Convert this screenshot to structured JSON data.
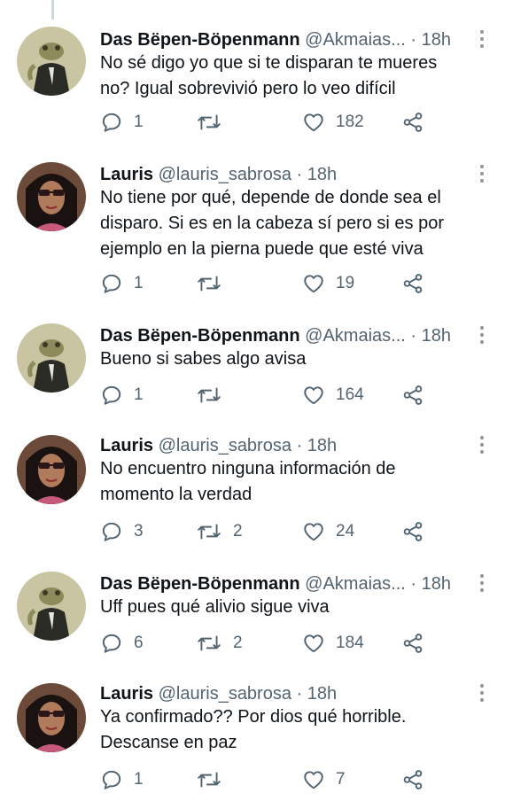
{
  "tweets": [
    {
      "author": "Das Bëpen-Böpenmann",
      "handle": "@Akmaias...",
      "separator": "·",
      "time": "18h",
      "lines": [
        "No sé digo yo que si te disparan te mueres",
        "no? Igual sobrevivió pero lo veo difícil"
      ],
      "replies": "1",
      "retweets": "",
      "likes": "182",
      "avatar": "frog-avatar"
    },
    {
      "author": "Lauris",
      "handle": "@lauris_sabrosa",
      "separator": "·",
      "time": "18h",
      "lines": [
        "No tiene por qué, depende de donde sea el",
        "disparo. Si es en la cabeza sí pero si es por",
        "ejemplo en la pierna puede que esté viva"
      ],
      "replies": "1",
      "retweets": "",
      "likes": "19",
      "avatar": "woman-avatar"
    },
    {
      "author": "Das Bëpen-Böpenmann",
      "handle": "@Akmaias...",
      "separator": "·",
      "time": "18h",
      "lines": [
        "Bueno si sabes algo avisa"
      ],
      "replies": "1",
      "retweets": "",
      "likes": "164",
      "avatar": "frog-avatar"
    },
    {
      "author": "Lauris",
      "handle": "@lauris_sabrosa",
      "separator": "·",
      "time": "18h",
      "lines": [
        "No encuentro ninguna información de",
        "momento la verdad"
      ],
      "replies": "3",
      "retweets": "2",
      "likes": "24",
      "avatar": "woman-avatar"
    },
    {
      "author": "Das Bëpen-Böpenmann",
      "handle": "@Akmaias...",
      "separator": "·",
      "time": "18h",
      "lines": [
        "Uff pues qué alivio sigue viva"
      ],
      "replies": "6",
      "retweets": "2",
      "likes": "184",
      "avatar": "frog-avatar"
    },
    {
      "author": "Lauris",
      "handle": "@lauris_sabrosa",
      "separator": "·",
      "time": "18h",
      "lines": [
        "Ya confirmado?? Por dios qué horrible.",
        "Descanse en paz"
      ],
      "replies": "1",
      "retweets": "",
      "likes": "7",
      "avatar": "woman-avatar"
    }
  ],
  "colors": {
    "text": "#0f1419",
    "secondary": "#536471",
    "thread_line": "#cfd9de"
  }
}
